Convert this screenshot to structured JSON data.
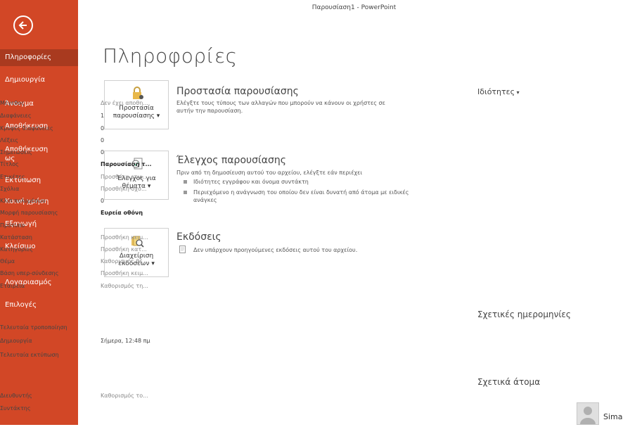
{
  "window": {
    "title": "Παρουσίαση1 - PowerPoint"
  },
  "sidebar": {
    "items": [
      {
        "label": "Πληροφορίες",
        "active": true
      },
      {
        "label": "Δημιουργία"
      },
      {
        "label": "Άνοιγμα"
      },
      {
        "label": "Αποθήκευση"
      },
      {
        "label": "Αποθήκευση ως"
      },
      {
        "label": "Εκτύπωση"
      },
      {
        "label": "Κοινή χρήση"
      },
      {
        "label": "Εξαγωγή"
      },
      {
        "label": "Κλείσιμο"
      },
      {
        "label": "Λογαριασμός"
      },
      {
        "label": "Επιλογές"
      }
    ],
    "accent": "#d24726"
  },
  "main": {
    "title": "Πληροφορίες",
    "protect": {
      "button_line1": "Προστασία",
      "button_line2": "παρουσίασης",
      "title": "Προστασία παρουσίασης",
      "text_line1": "Ελέγξτε τους τύπους των αλλαγών που μπορούν να κάνουν οι χρήστες σε",
      "text_line2": "αυτήν την παρουσίαση."
    },
    "inspect": {
      "button_line1": "Έλεγχος για",
      "button_line2": "θέματα",
      "title": "Έλεγχος παρουσίασης",
      "text": "Πριν από τη δημοσίευση αυτού του αρχείου, ελέγξτε εάν περιέχει",
      "bullet1": "Ιδιότητες εγγράφου και όνομα συντάκτη",
      "bullet2_line1": "Περιεχόμενο η ανάγνωση του οποίου δεν είναι δυνατή από άτομα με ειδικές",
      "bullet2_line2": "ανάγκες"
    },
    "versions": {
      "button_line1": "Διαχείριση",
      "button_line2": "εκδόσεων",
      "title": "Εκδόσεις",
      "text": "Δεν υπάρχουν προηγούμενες εκδόσεις αυτού του αρχείου."
    }
  },
  "properties": {
    "heading": "Ιδιότητες",
    "rows": [
      {
        "k": "Μέγεθος",
        "v": "Δεν έχει αποθη...",
        "style": "muted"
      },
      {
        "k": "Διαφάνειες",
        "v": "1",
        "style": ""
      },
      {
        "k": "Κρυφές διαφάνειες",
        "v": "0",
        "style": ""
      },
      {
        "k": "Λέξεις",
        "v": "0",
        "style": ""
      },
      {
        "k": "Σημειώσεις",
        "v": "0",
        "style": ""
      },
      {
        "k": "Τίτλος",
        "v": "Παρουσίαση τ...",
        "style": "bold"
      },
      {
        "k": "Ετικέτες",
        "v": "Προσθήκη ετικ...",
        "style": "muted"
      },
      {
        "k": "Σχόλια",
        "v": "Προσθήκη σχό...",
        "style": "muted"
      },
      {
        "k": "Κλιπ πολυμέσων",
        "v": "0",
        "style": ""
      },
      {
        "k": "Μορφή παρουσίασης",
        "v": "Ευρεία οθόνη",
        "style": "bold"
      },
      {
        "k": "Πρότυπο",
        "v": "",
        "style": ""
      },
      {
        "k": "Κατάσταση",
        "v": "Προσθήκη κειμ...",
        "style": "muted"
      },
      {
        "k": "Κατηγορίες",
        "v": "Προσθήκη κατ...",
        "style": "muted"
      },
      {
        "k": "Θέμα",
        "v": "Καθορισμός θέ...",
        "style": "muted"
      },
      {
        "k": "Βάση υπερ-σύνδεσης",
        "v": "Προσθήκη κειμ...",
        "style": "muted"
      },
      {
        "k": "Εταιρεία",
        "v": "Καθορισμός τη...",
        "style": "muted"
      }
    ],
    "dates_heading": "Σχετικές ημερομηνίες",
    "dates": [
      {
        "k": "Τελευταία τροποποίηση",
        "v": ""
      },
      {
        "k": "Δημιουργία",
        "v": "Σήμερα, 12:48 πμ"
      },
      {
        "k": "Τελευταία εκτύπωση",
        "v": ""
      }
    ],
    "people_heading": "Σχετικά άτομα",
    "people": [
      {
        "k": "Διευθυντής",
        "v": "Καθορισμός το..."
      },
      {
        "k": "Συντάκτης",
        "v": ""
      }
    ],
    "author_name": "Sima"
  }
}
